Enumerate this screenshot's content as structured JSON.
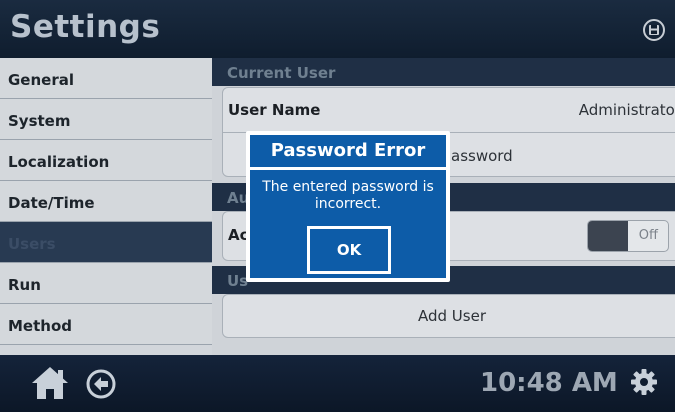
{
  "header": {
    "title": "Settings"
  },
  "sidebar": {
    "items": [
      {
        "label": "General"
      },
      {
        "label": "System"
      },
      {
        "label": "Localization"
      },
      {
        "label": "Date/Time"
      },
      {
        "label": "Users"
      },
      {
        "label": "Run"
      },
      {
        "label": "Method"
      }
    ],
    "active": "Users"
  },
  "main": {
    "current_user": {
      "section_title": "Current User",
      "user_name_label": "User Name",
      "user_name_value": "Administrator",
      "password_partial": "assword"
    },
    "auth": {
      "section_partial": "Au",
      "row_partial": "Ac",
      "toggle_text": "Off"
    },
    "users": {
      "section_partial": "Us",
      "add_user_label": "Add User"
    }
  },
  "modal": {
    "title": "Password Error",
    "message": "The entered password is incorrect.",
    "ok_label": "OK"
  },
  "footer": {
    "time": "10:48 AM"
  },
  "icons": [
    "save-icon",
    "home-icon",
    "back-icon",
    "gear-icon"
  ],
  "colors": {
    "dialog": "#0d5ca8",
    "header": "#1a2b40",
    "active_item": "#283a52"
  }
}
